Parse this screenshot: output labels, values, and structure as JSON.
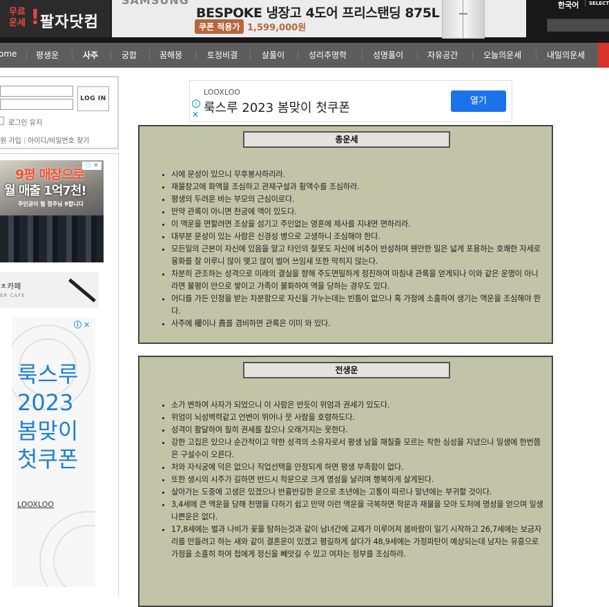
{
  "header": {
    "logo_free": "무료\n운세",
    "logo_mark": "!",
    "logo_name": "팔자닷컴",
    "banner_brand": "SAMSUNG",
    "banner_title": "BESPOKE 냉장고 4도어 프리스탠딩 875L",
    "banner_coupon": "쿠폰 적용가",
    "banner_price": "1,599,000원",
    "language": "한국어",
    "language_select": "SELECT"
  },
  "nav": {
    "items": [
      "ome",
      "평생운",
      "사주",
      "궁합",
      "꿈해몽",
      "토정비결",
      "살풀이",
      "성리추명학",
      "성명풀이",
      "자유공간",
      "오늘의운세",
      "내일의운세"
    ]
  },
  "login": {
    "button": "LOG IN",
    "keep_login": "로그인 유지",
    "signup": "원 가입",
    "find": "아이디/비밀번호 찾기"
  },
  "left_ads": {
    "ad1_line1": "9평 매장으로",
    "ad1_line2": "월 매출 1억7천!",
    "ad1_line3": "주인공이 될 점주님 9합니다",
    "cafe_line1": "ㅊ카페",
    "cafe_line2": "ER CAFE",
    "ad2_text": "룩스루 2023 봄맞이 첫쿠폰",
    "ad2_brand": "LOOXLOO"
  },
  "top_ad": {
    "brand": "LOOXLOO",
    "headline": "룩스루 2023 봄맞이 첫쿠폰",
    "open_button": "열기"
  },
  "sections": {
    "total": {
      "title": "총운세",
      "items": [
        "시에 문성이 있으니 무후봉사하리라.",
        "재물창고에 화액을 조심하고 관재구설과 횡액수를 조심하라.",
        "평생의 두려운 바는 부모의 근심이로다.",
        "만약 관록이 아니면 천궁에 액이 있도다.",
        "이 액운을 면할려면 조상을 섬기고 주인없는 영혼에 제사를 지내면 면하리라.",
        "대부분 문성이 있는 사람은 신경성 병으로 고생하니 조심해야 한다.",
        "모든일의 근본이 자신에 있음을 알고 타인의 잘못도 자신에 비추어 반성하며 웬만한 일은 넓게 포용하는 호쾌한 자세로 융화를 잘 이루니 많이 맺고 많이 벌어 쓰임새 또한 막히지 않는다.",
        "차분히 관조하는 성격으로 미래의 결실을 향해 주도면밀하게 정진하여 마침내 관록을 얻게되나 이와 같은 운명이 아니라면 불평이 안으로 쌓이고 가족이 불화하여 액을 당하는 경우도 있다.",
        "어디를 가든 인정을 받는 차분함으로 자신을 가누는데는 빈틈이 없으나 혹 가정에 소홀하여 생기는 액운을 조심해야 한다.",
        "사주에 權이나 貴를 겸비하면 관록은 이미 와 있다."
      ]
    },
    "early": {
      "title": "전생운",
      "items": [
        "소가 변하여 사자가 되었으니 이 사람은 반듯이 위엄과 권세가 있도다.",
        "위엄이 뇌성벽력같고 언변이 뛰어나 뭇 사람을 호령하도다.",
        "성격이 활달하여 필히 권세를 잡으나 오래가지는 못한다.",
        "강한 고집은 있으나 순간적이고 약한 성격의 소유자로서 평생 남을 해칠줄 모르는 착한 심성을 지녔으나 일생에 한번쯤은 구설수이 오른다.",
        "처와 자식궁에 덕은 없으나 직업선택을 안정되게 하면 평생 부족함이 없다.",
        "또한 생시의 시주가 길하면 반드시 학문으로 크게 명성을 날리며 행복하게 살게된다.",
        "살아가는 도중에 고생은 있겠으나 반흉반길한 운으로 초년에는 고통이 따르나 말년에는 부귀할 것이다.",
        "3,4세에 큰 액운을 당해 천명을 다하기 쉽고 만약 이런 액운을 극복하면 학문과 재물을 모아 도처에 명성을 얻으며 일생 나쁜운은 없다.",
        "17,8세에는 벌과 나비가 꽃을 탐하는것과 같이 남녀간에 교제가 이루어져 봄바람이 일기 시작하고 26,7세에는 보금자리를 만들려고 하는 새와 같이 결혼운이 있겠고 평길하게 살다가 48,9세에는 가정파탄이 예상되는데 남자는 유흥으로 가정을 소홀히 하여 첩에게 정신을 빼앗길 수 있고 여자는 정부를 조심하라."
      ]
    }
  },
  "colors": {
    "header_bg": "#181818",
    "nav_bg": "#5d5d5d",
    "box_bg": "#c2c4a7",
    "accent_red": "#e8453c",
    "open_button": "#1a73e8"
  }
}
